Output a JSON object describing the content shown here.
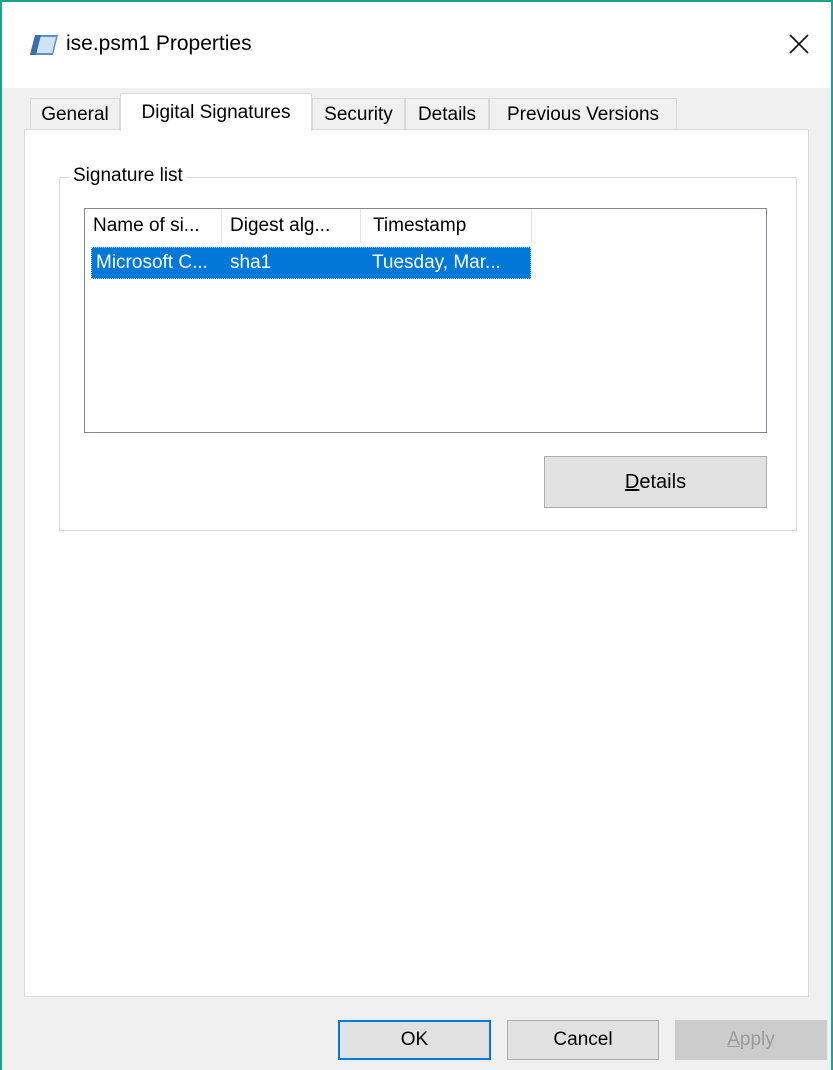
{
  "window": {
    "title": "ise.psm1 Properties",
    "accent_color": "#1ca38c",
    "icon": "script-file-icon",
    "close_icon": "close-icon"
  },
  "tabs": [
    {
      "label": "General",
      "active": false
    },
    {
      "label": "Digital Signatures",
      "active": true
    },
    {
      "label": "Security",
      "active": false
    },
    {
      "label": "Details",
      "active": false
    },
    {
      "label": "Previous Versions",
      "active": false
    }
  ],
  "signature_list": {
    "group_label": "Signature list",
    "columns": [
      "Name of si...",
      "Digest alg...",
      "Timestamp"
    ],
    "rows": [
      {
        "name": "Microsoft C...",
        "digest": "sha1",
        "timestamp": "Tuesday, Mar...",
        "selected": true
      }
    ],
    "selection_color": "#0078d7"
  },
  "details_button": {
    "label_prefix": "",
    "label_underline": "D",
    "label_rest": "etails"
  },
  "footer": {
    "ok_label": "OK",
    "cancel_label": "Cancel",
    "apply_underline": "A",
    "apply_rest": "pply",
    "apply_enabled": false
  }
}
